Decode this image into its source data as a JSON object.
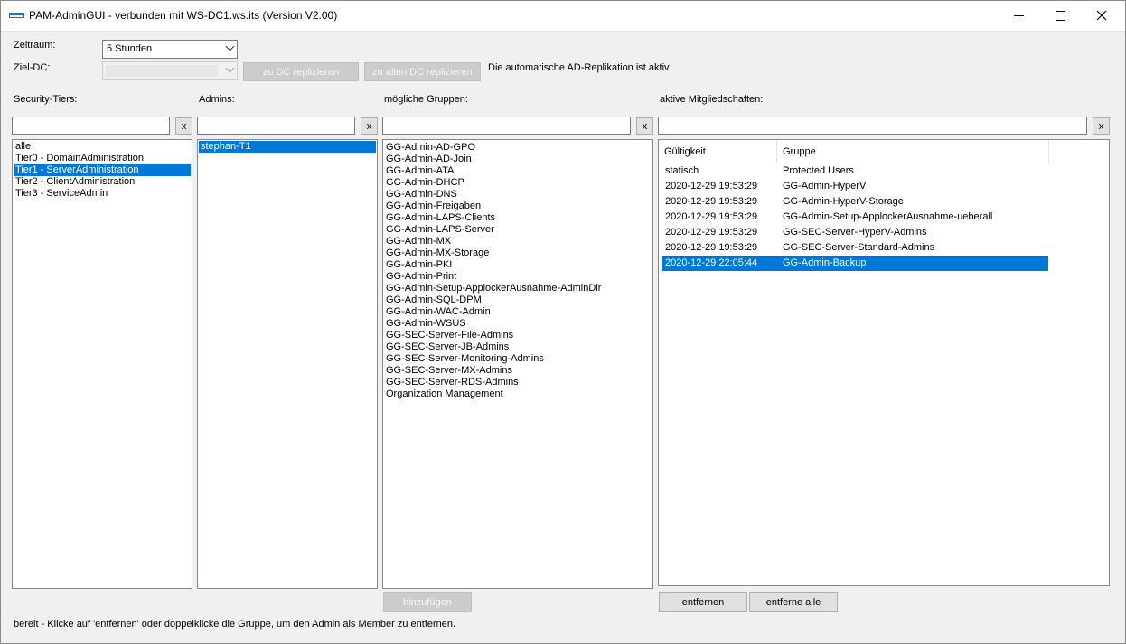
{
  "window": {
    "title": "PAM-AdminGUI - verbunden mit WS-DC1.ws.its (Version V2.00)",
    "controls": {
      "minimize": "—",
      "maximize": "☐",
      "close": "✕"
    }
  },
  "toolbar": {
    "zeitraum_label": "Zeitraum:",
    "zeitraum_value": "5 Stunden",
    "ziel_dc_label": "Ziel-DC:",
    "ziel_dc_value": "",
    "replicate_dc_label": "zu DC replizieren",
    "replicate_all_label": "zu allen DC replizieren",
    "replication_status": "Die automatische AD-Replikation ist aktiv."
  },
  "columns": {
    "tiers_label": "Security-Tiers:",
    "admins_label": "Admins:",
    "groups_label": "mögliche Gruppen:",
    "memberships_label": "aktive Mitgliedschaften:",
    "clear_label": "x"
  },
  "tiers": [
    {
      "label": "alle",
      "selected": false
    },
    {
      "label": "Tier0 - DomainAdministration",
      "selected": false
    },
    {
      "label": "Tier1 - ServerAdministration",
      "selected": true
    },
    {
      "label": "Tier2 - ClientAdministration",
      "selected": false
    },
    {
      "label": "Tier3 - ServiceAdmin",
      "selected": false
    }
  ],
  "admins": [
    {
      "label": "stephan-T1",
      "selected": true
    }
  ],
  "groups": [
    "GG-Admin-AD-GPO",
    "GG-Admin-AD-Join",
    "GG-Admin-ATA",
    "GG-Admin-DHCP",
    "GG-Admin-DNS",
    "GG-Admin-Freigaben",
    "GG-Admin-LAPS-Clients",
    "GG-Admin-LAPS-Server",
    "GG-Admin-MX",
    "GG-Admin-MX-Storage",
    "GG-Admin-PKI",
    "GG-Admin-Print",
    "GG-Admin-Setup-ApplockerAusnahme-AdminDir",
    "GG-Admin-SQL-DPM",
    "GG-Admin-WAC-Admin",
    "GG-Admin-WSUS",
    "GG-SEC-Server-File-Admins",
    "GG-SEC-Server-JB-Admins",
    "GG-SEC-Server-Monitoring-Admins",
    "GG-SEC-Server-MX-Admins",
    "GG-SEC-Server-RDS-Admins",
    "Organization Management"
  ],
  "memberships": {
    "headers": {
      "validity": "Gültigkeit",
      "group": "Gruppe"
    },
    "rows": [
      {
        "validity": "statisch",
        "group": "Protected Users",
        "selected": false
      },
      {
        "validity": "2020-12-29 19:53:29",
        "group": "GG-Admin-HyperV",
        "selected": false
      },
      {
        "validity": "2020-12-29 19:53:29",
        "group": "GG-Admin-HyperV-Storage",
        "selected": false
      },
      {
        "validity": "2020-12-29 19:53:29",
        "group": "GG-Admin-Setup-ApplockerAusnahme-ueberall",
        "selected": false
      },
      {
        "validity": "2020-12-29 19:53:29",
        "group": "GG-SEC-Server-HyperV-Admins",
        "selected": false
      },
      {
        "validity": "2020-12-29 19:53:29",
        "group": "GG-SEC-Server-Standard-Admins",
        "selected": false
      },
      {
        "validity": "2020-12-29 22:05:44",
        "group": "GG-Admin-Backup",
        "selected": true
      }
    ]
  },
  "actions": {
    "add_label": "hinzufügen",
    "remove_label": "entfernen",
    "remove_all_label": "entferne alle"
  },
  "status": {
    "text": "bereit - Klicke auf 'entfernen' oder doppelklicke die Gruppe, um den Admin als Member zu entfernen."
  }
}
